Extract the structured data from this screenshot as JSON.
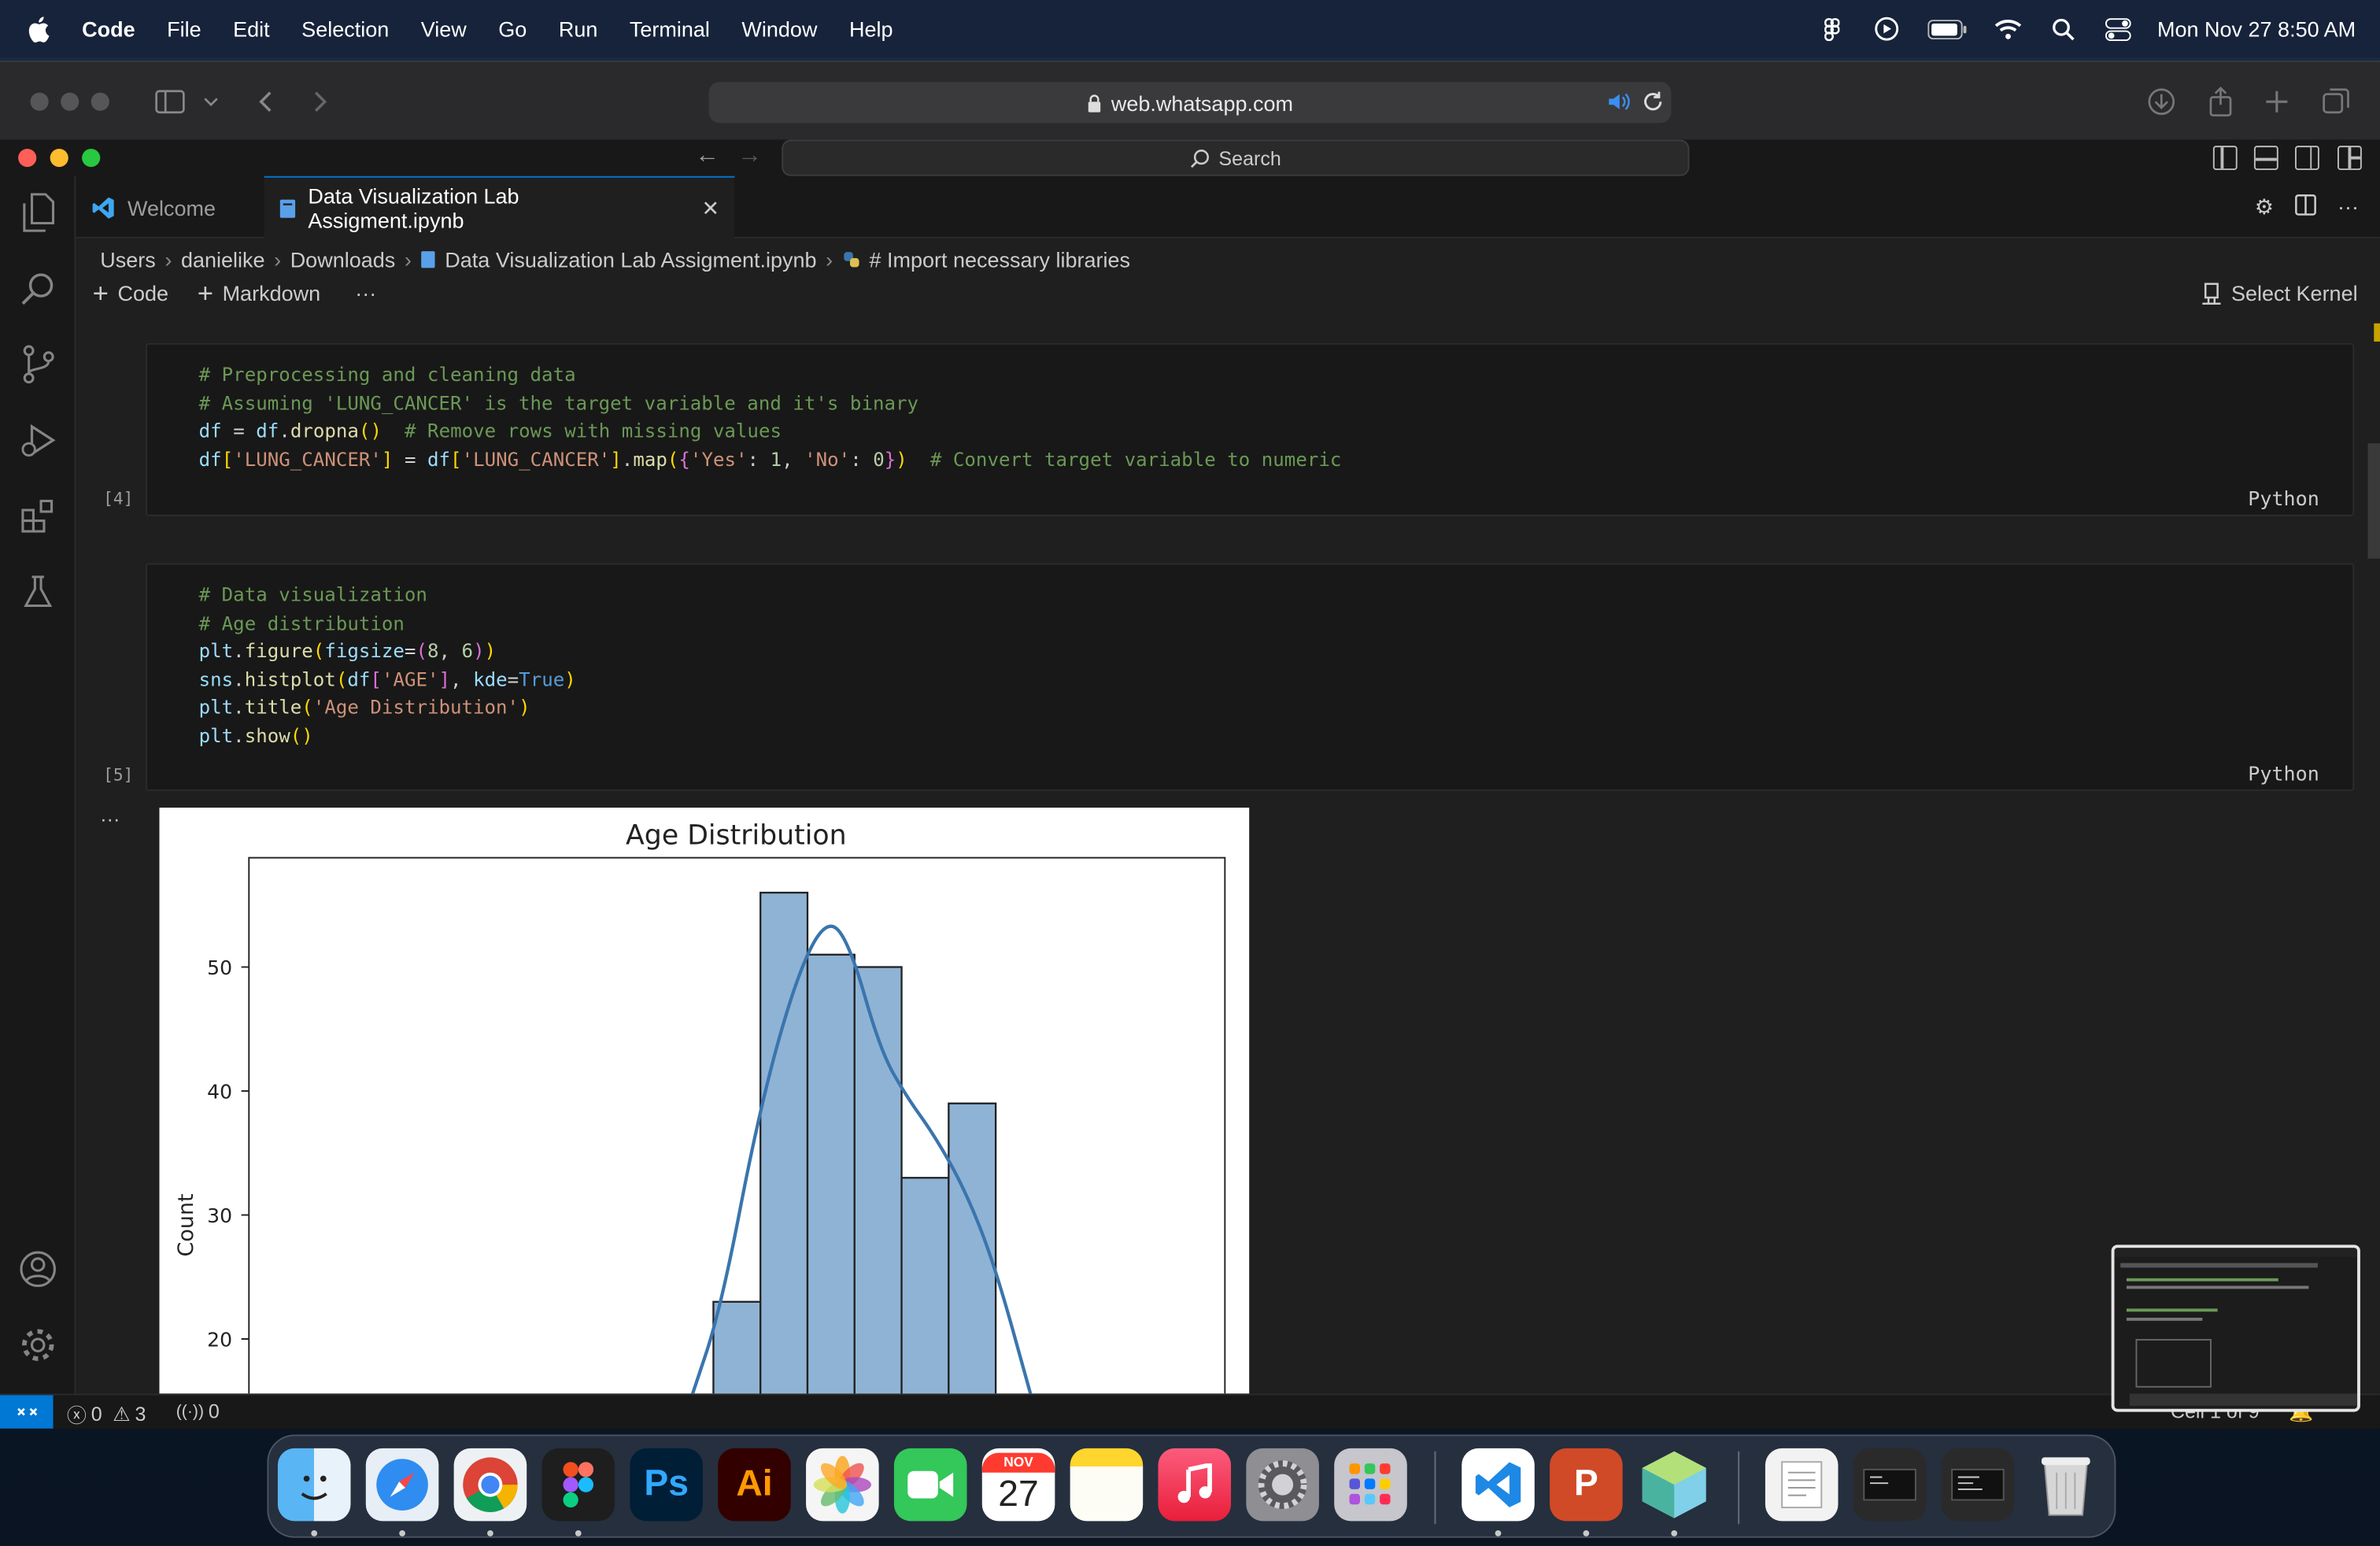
{
  "menubar": {
    "app": "Code",
    "items": [
      "File",
      "Edit",
      "Selection",
      "View",
      "Go",
      "Run",
      "Terminal",
      "Window",
      "Help"
    ],
    "clock": "Mon Nov 27  8:50 AM"
  },
  "browser": {
    "url": "web.whatsapp.com"
  },
  "vscode": {
    "search_label": "Search",
    "tabs": [
      {
        "label": "Welcome"
      },
      {
        "label": "Data Visualization Lab Assigment.ipynb"
      }
    ],
    "breadcrumb": [
      "Users",
      "danielike",
      "Downloads",
      "Data Visualization Lab Assigment.ipynb",
      "# Import necessary libraries"
    ],
    "toolbar": {
      "code": "Code",
      "markdown": "Markdown",
      "more": "···",
      "kernel": "Select Kernel"
    },
    "cells": [
      {
        "exec": "[4]",
        "lang": "Python"
      },
      {
        "exec": "[5]",
        "lang": "Python"
      }
    ],
    "output_more": "···",
    "status": {
      "errors": "0",
      "warnings": "3",
      "ports": "0",
      "cell_info": "Cell 1 of 9"
    }
  },
  "chart_data": {
    "type": "bar",
    "title": "Age Distribution",
    "ylabel": "Count",
    "xlabel": "",
    "yticks": [
      20,
      30,
      40,
      50
    ],
    "ylim_visible": [
      16,
      57
    ],
    "bins": [
      23,
      56,
      51,
      50,
      33,
      39
    ],
    "kde": "line overlay",
    "color": "#8fb3d5",
    "line_color": "#3a75ad"
  },
  "dock": {
    "calendar_month": "NOV",
    "calendar_day": "27"
  },
  "colors": {
    "accent": "#0078d4"
  }
}
